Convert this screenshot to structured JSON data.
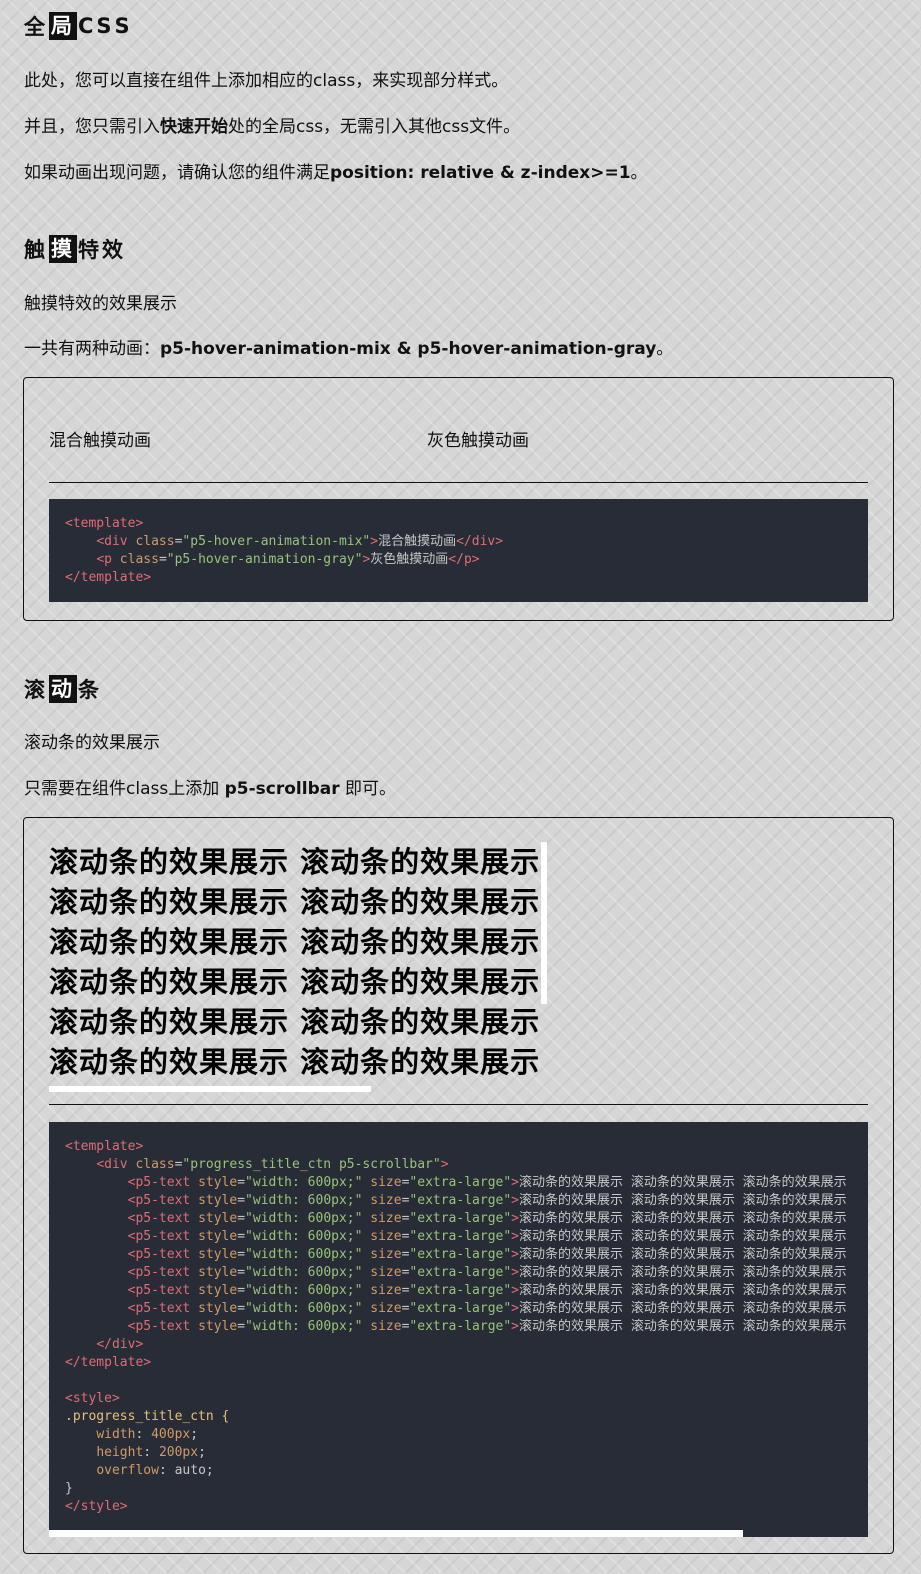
{
  "global_css": {
    "heading_chars": [
      "全",
      "局",
      "C",
      "S",
      "S"
    ],
    "boxed_index": 1,
    "p1": "此处，您可以直接在组件上添加相应的class，来实现部分样式。",
    "p2_before": "并且，您只需引入",
    "p2_bold": "快速开始",
    "p2_after": "处的全局css，无需引入其他css文件。",
    "p3_before": "如果动画出现问题，请确认您的组件满足",
    "p3_bold": "position: relative & z-index>=1",
    "p3_after": "。"
  },
  "touch": {
    "heading_chars": [
      "触",
      "摸",
      "特",
      "效"
    ],
    "p1": "触摸特效的效果展示",
    "p2_before": "一共有两种动画：",
    "p2_bold": "p5-hover-animation-mix & p5-hover-animation-gray",
    "p2_after": "。",
    "demo_mix": "混合触摸动画",
    "demo_gray": "灰色触摸动画",
    "code": {
      "template_open": "template",
      "div": "div",
      "p": "p",
      "class_attr": "class",
      "mix_class": "\"p5-hover-animation-mix\"",
      "gray_class": "\"p5-hover-animation-gray\"",
      "mix_text": "混合触摸动画",
      "gray_text": "灰色触摸动画"
    }
  },
  "scrollbar": {
    "heading_chars": [
      "滚",
      "动",
      "条"
    ],
    "p1": "滚动条的效果展示",
    "p2_before": "只需要在组件class上添加 ",
    "p2_bold": "p5-scrollbar",
    "p2_after": " 即可。",
    "demo_line": "滚动条的效果展示 滚动条的效果展示",
    "demo_lines_count": 6,
    "code": {
      "div_class": "\"progress_title_ctn p5-scrollbar\"",
      "p5_tag": "p5-text",
      "style_attr": "style",
      "style_val": "\"width: 600px;\"",
      "size_attr": "size",
      "size_val": "\"extra-large\"",
      "row_text": "滚动条的效果展示 滚动条的效果展示 滚动条的效果展示",
      "row_count": 9,
      "css_selector": ".progress_title_ctn {",
      "css_width_prop": "width",
      "css_width_val": "400px",
      "css_height_prop": "height",
      "css_height_val": "200px",
      "css_overflow_prop": "overflow",
      "css_overflow_val": "auto",
      "css_close": "}"
    }
  }
}
